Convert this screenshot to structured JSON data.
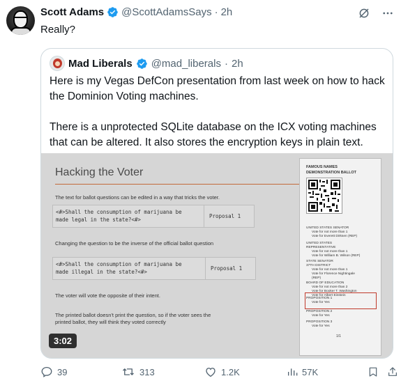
{
  "tweet": {
    "author_name": "Scott Adams",
    "handle": "@ScottAdamsSays",
    "separator": "·",
    "time": "2h",
    "text": "Really?"
  },
  "quoted": {
    "author_name": "Mad Liberals",
    "handle": "@mad_liberals",
    "separator": "·",
    "time": "2h",
    "paragraph1": "Here is my Vegas DefCon presentation from last week on how to hack the Dominion Voting machines.",
    "paragraph2": "There is a unprotected SQLite database on the ICX voting machines that can be altered.  It also stores the encryption keys in plain text.",
    "video_duration": "3:02",
    "slide": {
      "title": "Hacking the Voter",
      "line1": "The text for ballot questions can be edited in a way that tricks the voter.",
      "box1_left_1": "<#>Shall the consumption of marijuana be",
      "box1_left_2": "made legal in the state?<#>",
      "box1_right": "Proposal 1",
      "line2": "Changing the question to be the inverse of the official ballot question",
      "box2_left_1": "<#>Shall the consumption of marijuana be",
      "box2_left_2": "made illegal in the state?<#>",
      "box2_right": "Proposal 1",
      "line3": "The voter will vote the opposite of their intent.",
      "line4a": "The printed ballot doesn't print the question, so if the voter sees the",
      "line4b": "printed ballot, they will think they voted correctly"
    },
    "ballot": {
      "title1": "FAMOUS NAMES",
      "title2": "DEMONSTRATION BALLOT",
      "s1_head": "UNITED STATES SENATOR",
      "s1_l1": "Vote for not more than 1",
      "s1_l2": "Vote for Everett Dirksen (REP)",
      "s2_head1": "UNITED STATES",
      "s2_head2": "REPRESENTATIVE",
      "s2_l1": "Vote for not more than 1",
      "s2_l2": "Vote for William B. Wilson (REP)",
      "s3_head1": "STATE SENATOR",
      "s3_head2": "37TH DISTRICT",
      "s3_l1": "Vote for not more than 1",
      "s3_l2": "Vote for Florence Nightingale",
      "s3_l3": "(REP)",
      "s4_head": "BOARD OF EDUCATION",
      "s4_l1": "Vote for not more than 2",
      "s4_l2": "Vote for Booker T. Washington",
      "s4_l3": "Vote for Albert Einstein",
      "p1_head": "PROPOSITION 1",
      "p1_l1": "Vote for Yes",
      "p2_head": "PROPOSITION 2",
      "p2_l1": "Vote for Yes",
      "p3_head": "PROPOSITION 3",
      "p3_l1": "Vote for Yes",
      "page": "1/1"
    }
  },
  "actions": {
    "replies": "39",
    "reposts": "313",
    "likes": "1.2K",
    "views": "57K"
  },
  "icons": [
    "verified-badge-icon",
    "grok-icon",
    "more-icon",
    "reply-icon",
    "repost-icon",
    "like-icon",
    "views-icon",
    "bookmark-icon",
    "share-icon"
  ],
  "colors": {
    "verified": "#1d9bf0",
    "muted": "#536471",
    "text": "#0f1419",
    "border": "#cfd9de",
    "highlight": "#c0392b"
  }
}
